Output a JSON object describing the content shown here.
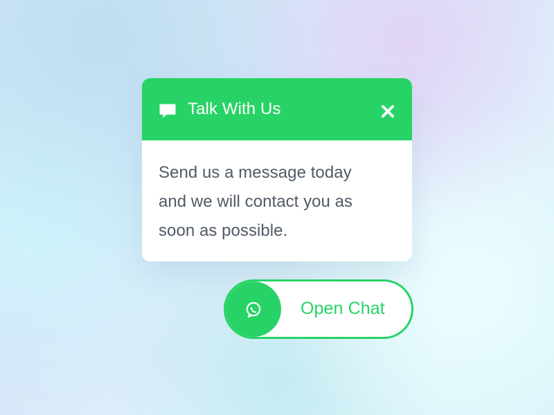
{
  "chat_card": {
    "title": "Talk With Us",
    "message_lines": [
      "Send us a message today",
      "and we will contact you as",
      "soon as possible."
    ],
    "header_icon": "chat-bubble-icon",
    "close_icon": "close-icon"
  },
  "open_chat_button": {
    "label": "Open Chat",
    "icon": "whatsapp-icon"
  },
  "colors": {
    "accent": "#27d366",
    "card_background": "#ffffff",
    "body_text": "#505a66",
    "page_background": "#d9edf8"
  }
}
